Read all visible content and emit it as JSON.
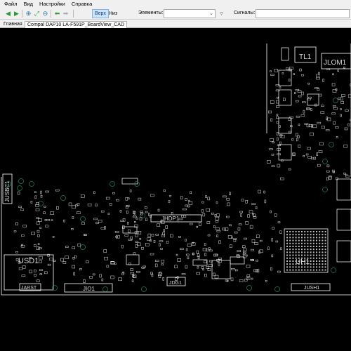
{
  "menu": {
    "items": [
      "Файл",
      "Вид",
      "Настройки",
      "Справка"
    ]
  },
  "toolbar": {
    "top_label": "Верх",
    "bottom_label": "Низ",
    "elements_label": "Элементы:",
    "elements_value": "",
    "signals_label": "Сигналы:",
    "signals_value": ""
  },
  "tabs": [
    {
      "label": "Главная"
    },
    {
      "label": "Compal DAP10 LA-F591P_BoardView_CAD"
    }
  ],
  "board": {
    "background": "#000000",
    "outline_color": "#ffffff",
    "via_color": "#1f7a5a",
    "component_labels": [
      "TL1",
      "JLOM1",
      "JUSBC1",
      "JHDP1",
      "USD1",
      "UH1",
      "JDG1",
      "JARST",
      "JIO1",
      "JUSH1"
    ]
  }
}
